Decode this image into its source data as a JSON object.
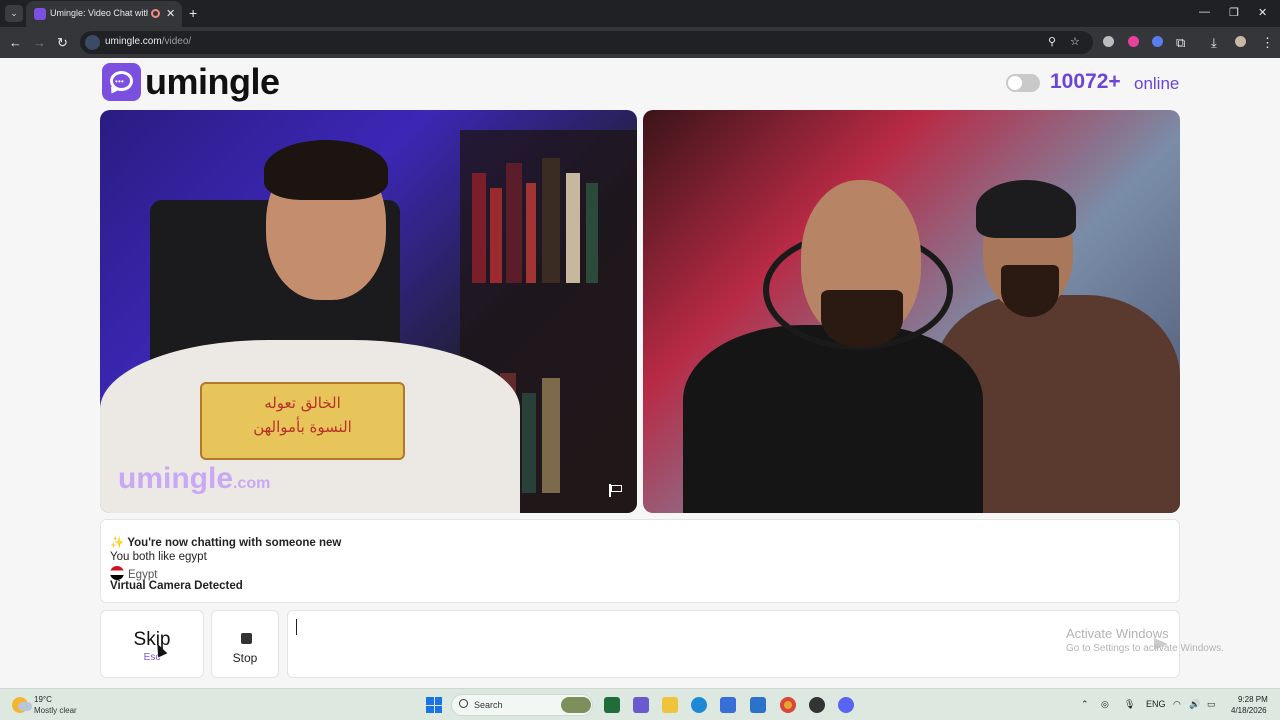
{
  "browser": {
    "tab_title": "Umingle: Video Chat with S",
    "tab_close": "✕",
    "new_tab": "+",
    "url_host": "umingle.com",
    "url_path": "/video/",
    "window_controls": [
      "—",
      "❐",
      "✕"
    ]
  },
  "header": {
    "logo_text": "umingle",
    "online_count": "10072+",
    "online_label": "online"
  },
  "video_left": {
    "watermark": "umingle",
    "watermark_suffix": ".com",
    "shirt_text_line1": "الخالق تعوله",
    "shirt_text_line2": "النسوة بأموالهن"
  },
  "info": {
    "headline": "You're now chatting with someone new",
    "common_interest": "You both like egypt",
    "country": "Egypt",
    "camera_notice": "Virtual Camera Detected"
  },
  "controls": {
    "skip_label": "Skip",
    "skip_hint": "Esc",
    "stop_label": "Stop",
    "chat_placeholder": ""
  },
  "os_overlay": {
    "activate_title": "Activate Windows",
    "activate_sub": "Go to Settings to activate Windows."
  },
  "taskbar": {
    "temperature": "19°C",
    "condition": "Mostly clear",
    "search_label": "Search",
    "language": "ENG",
    "time": "9:28 PM",
    "date": "4/18/2026"
  },
  "colors": {
    "brand": "#7b4fe0",
    "online_text": "#6b45d8",
    "egypt_flag": [
      "#ce1126",
      "#ffffff",
      "#000000"
    ]
  }
}
